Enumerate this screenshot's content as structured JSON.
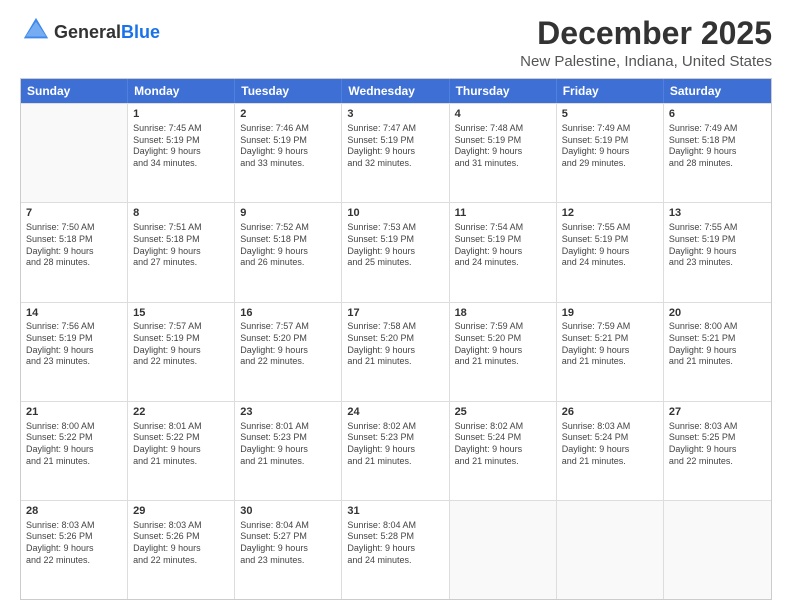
{
  "logo": {
    "general": "General",
    "blue": "Blue"
  },
  "header": {
    "month": "December 2025",
    "location": "New Palestine, Indiana, United States"
  },
  "weekdays": [
    "Sunday",
    "Monday",
    "Tuesday",
    "Wednesday",
    "Thursday",
    "Friday",
    "Saturday"
  ],
  "rows": [
    [
      {
        "day": "",
        "text": ""
      },
      {
        "day": "1",
        "text": "Sunrise: 7:45 AM\nSunset: 5:19 PM\nDaylight: 9 hours\nand 34 minutes."
      },
      {
        "day": "2",
        "text": "Sunrise: 7:46 AM\nSunset: 5:19 PM\nDaylight: 9 hours\nand 33 minutes."
      },
      {
        "day": "3",
        "text": "Sunrise: 7:47 AM\nSunset: 5:19 PM\nDaylight: 9 hours\nand 32 minutes."
      },
      {
        "day": "4",
        "text": "Sunrise: 7:48 AM\nSunset: 5:19 PM\nDaylight: 9 hours\nand 31 minutes."
      },
      {
        "day": "5",
        "text": "Sunrise: 7:49 AM\nSunset: 5:19 PM\nDaylight: 9 hours\nand 29 minutes."
      },
      {
        "day": "6",
        "text": "Sunrise: 7:49 AM\nSunset: 5:18 PM\nDaylight: 9 hours\nand 28 minutes."
      }
    ],
    [
      {
        "day": "7",
        "text": "Sunrise: 7:50 AM\nSunset: 5:18 PM\nDaylight: 9 hours\nand 28 minutes."
      },
      {
        "day": "8",
        "text": "Sunrise: 7:51 AM\nSunset: 5:18 PM\nDaylight: 9 hours\nand 27 minutes."
      },
      {
        "day": "9",
        "text": "Sunrise: 7:52 AM\nSunset: 5:18 PM\nDaylight: 9 hours\nand 26 minutes."
      },
      {
        "day": "10",
        "text": "Sunrise: 7:53 AM\nSunset: 5:19 PM\nDaylight: 9 hours\nand 25 minutes."
      },
      {
        "day": "11",
        "text": "Sunrise: 7:54 AM\nSunset: 5:19 PM\nDaylight: 9 hours\nand 24 minutes."
      },
      {
        "day": "12",
        "text": "Sunrise: 7:55 AM\nSunset: 5:19 PM\nDaylight: 9 hours\nand 24 minutes."
      },
      {
        "day": "13",
        "text": "Sunrise: 7:55 AM\nSunset: 5:19 PM\nDaylight: 9 hours\nand 23 minutes."
      }
    ],
    [
      {
        "day": "14",
        "text": "Sunrise: 7:56 AM\nSunset: 5:19 PM\nDaylight: 9 hours\nand 23 minutes."
      },
      {
        "day": "15",
        "text": "Sunrise: 7:57 AM\nSunset: 5:19 PM\nDaylight: 9 hours\nand 22 minutes."
      },
      {
        "day": "16",
        "text": "Sunrise: 7:57 AM\nSunset: 5:20 PM\nDaylight: 9 hours\nand 22 minutes."
      },
      {
        "day": "17",
        "text": "Sunrise: 7:58 AM\nSunset: 5:20 PM\nDaylight: 9 hours\nand 21 minutes."
      },
      {
        "day": "18",
        "text": "Sunrise: 7:59 AM\nSunset: 5:20 PM\nDaylight: 9 hours\nand 21 minutes."
      },
      {
        "day": "19",
        "text": "Sunrise: 7:59 AM\nSunset: 5:21 PM\nDaylight: 9 hours\nand 21 minutes."
      },
      {
        "day": "20",
        "text": "Sunrise: 8:00 AM\nSunset: 5:21 PM\nDaylight: 9 hours\nand 21 minutes."
      }
    ],
    [
      {
        "day": "21",
        "text": "Sunrise: 8:00 AM\nSunset: 5:22 PM\nDaylight: 9 hours\nand 21 minutes."
      },
      {
        "day": "22",
        "text": "Sunrise: 8:01 AM\nSunset: 5:22 PM\nDaylight: 9 hours\nand 21 minutes."
      },
      {
        "day": "23",
        "text": "Sunrise: 8:01 AM\nSunset: 5:23 PM\nDaylight: 9 hours\nand 21 minutes."
      },
      {
        "day": "24",
        "text": "Sunrise: 8:02 AM\nSunset: 5:23 PM\nDaylight: 9 hours\nand 21 minutes."
      },
      {
        "day": "25",
        "text": "Sunrise: 8:02 AM\nSunset: 5:24 PM\nDaylight: 9 hours\nand 21 minutes."
      },
      {
        "day": "26",
        "text": "Sunrise: 8:03 AM\nSunset: 5:24 PM\nDaylight: 9 hours\nand 21 minutes."
      },
      {
        "day": "27",
        "text": "Sunrise: 8:03 AM\nSunset: 5:25 PM\nDaylight: 9 hours\nand 22 minutes."
      }
    ],
    [
      {
        "day": "28",
        "text": "Sunrise: 8:03 AM\nSunset: 5:26 PM\nDaylight: 9 hours\nand 22 minutes."
      },
      {
        "day": "29",
        "text": "Sunrise: 8:03 AM\nSunset: 5:26 PM\nDaylight: 9 hours\nand 22 minutes."
      },
      {
        "day": "30",
        "text": "Sunrise: 8:04 AM\nSunset: 5:27 PM\nDaylight: 9 hours\nand 23 minutes."
      },
      {
        "day": "31",
        "text": "Sunrise: 8:04 AM\nSunset: 5:28 PM\nDaylight: 9 hours\nand 24 minutes."
      },
      {
        "day": "",
        "text": ""
      },
      {
        "day": "",
        "text": ""
      },
      {
        "day": "",
        "text": ""
      }
    ]
  ]
}
